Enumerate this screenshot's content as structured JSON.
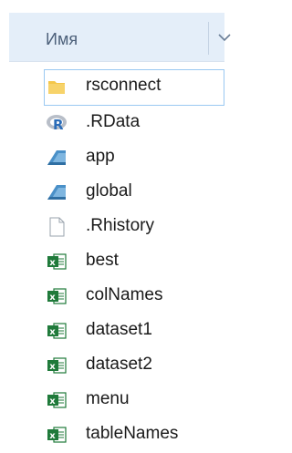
{
  "header": {
    "column_name": "Имя"
  },
  "files": [
    {
      "name": "rsconnect",
      "icon": "folder-icon",
      "selected": true
    },
    {
      "name": ".RData",
      "icon": "r-data-icon",
      "selected": false
    },
    {
      "name": "app",
      "icon": "rstudio-file-icon",
      "selected": false
    },
    {
      "name": "global",
      "icon": "rstudio-file-icon",
      "selected": false
    },
    {
      "name": ".Rhistory",
      "icon": "blank-file-icon",
      "selected": false
    },
    {
      "name": "best",
      "icon": "excel-file-icon",
      "selected": false
    },
    {
      "name": "colNames",
      "icon": "excel-file-icon",
      "selected": false
    },
    {
      "name": "dataset1",
      "icon": "excel-file-icon",
      "selected": false
    },
    {
      "name": "dataset2",
      "icon": "excel-file-icon",
      "selected": false
    },
    {
      "name": "menu",
      "icon": "excel-file-icon",
      "selected": false
    },
    {
      "name": "tableNames",
      "icon": "excel-file-icon",
      "selected": false
    }
  ],
  "colors": {
    "header_bg": "#e4eef9",
    "selection_border": "#9ac8f2",
    "excel_green": "#1f7a3a",
    "folder_yellow": "#f4c74a",
    "r_blue": "#2b6cb8"
  }
}
